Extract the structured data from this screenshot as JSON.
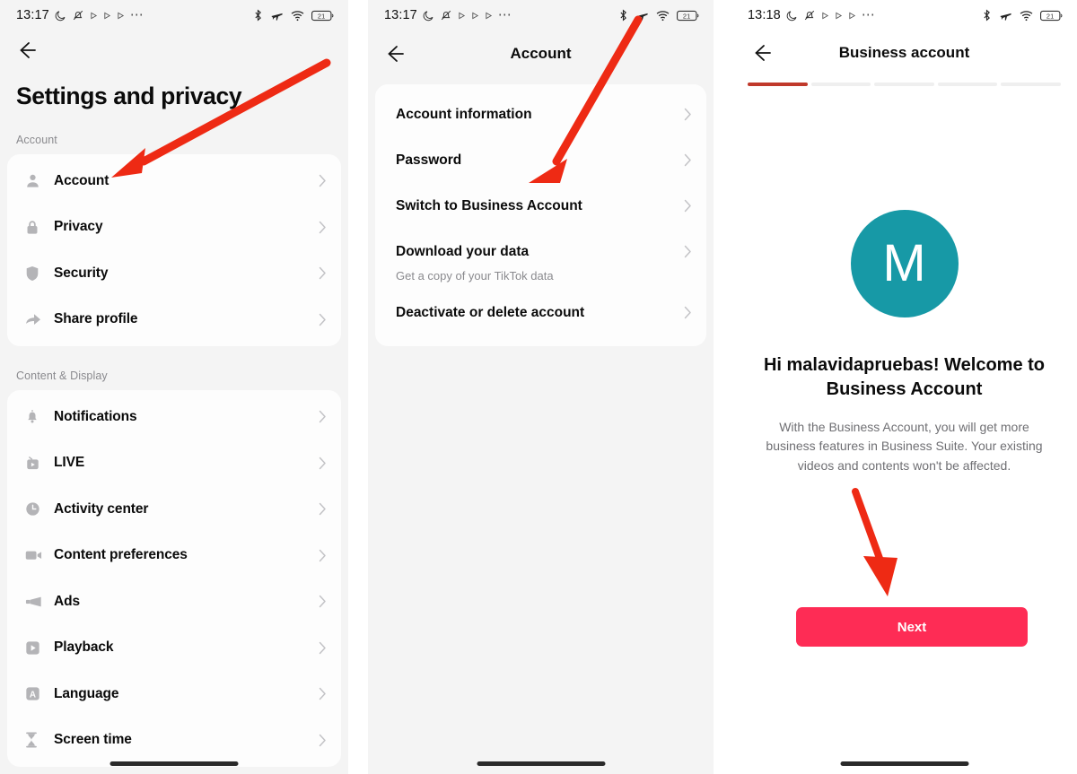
{
  "accent": {
    "arrow_red": "#ee2a14",
    "button_red": "#fe2c55",
    "avatar_teal": "#1799a6",
    "progress_active": "#c0392b"
  },
  "panel1": {
    "status_bar": {
      "time": "13:17",
      "left_icons": [
        "moon-icon",
        "bell-muted-icon",
        "play-icon",
        "play-icon",
        "play-icon",
        "ellipsis-icon"
      ],
      "right_icons": [
        "bluetooth-icon",
        "airplane-icon",
        "wifi-icon",
        "battery-icon"
      ],
      "battery_level": "21"
    },
    "back_label": "back-arrow",
    "title": "Settings and privacy",
    "sections": [
      {
        "label": "Account",
        "items": [
          {
            "icon": "person-icon",
            "label": "Account"
          },
          {
            "icon": "lock-icon",
            "label": "Privacy"
          },
          {
            "icon": "shield-icon",
            "label": "Security"
          },
          {
            "icon": "share-arrow-icon",
            "label": "Share profile"
          }
        ]
      },
      {
        "label": "Content & Display",
        "items": [
          {
            "icon": "bell-icon",
            "label": "Notifications"
          },
          {
            "icon": "live-icon",
            "label": "LIVE"
          },
          {
            "icon": "clock-icon",
            "label": "Activity center"
          },
          {
            "icon": "video-camera-icon",
            "label": "Content preferences"
          },
          {
            "icon": "megaphone-icon",
            "label": "Ads"
          },
          {
            "icon": "play-square-icon",
            "label": "Playback"
          },
          {
            "icon": "letter-a-icon",
            "label": "Language"
          },
          {
            "icon": "hourglass-icon",
            "label": "Screen time"
          }
        ]
      }
    ]
  },
  "panel2": {
    "status_bar": {
      "time": "13:17",
      "battery_level": "21"
    },
    "title": "Account",
    "items": [
      {
        "label": "Account information",
        "sub": ""
      },
      {
        "label": "Password",
        "sub": ""
      },
      {
        "label": "Switch to Business Account",
        "sub": ""
      },
      {
        "label": "Download your data",
        "sub": "Get a copy of your TikTok data"
      },
      {
        "label": "Deactivate or delete account",
        "sub": ""
      }
    ]
  },
  "panel3": {
    "status_bar": {
      "time": "13:18",
      "battery_level": "21"
    },
    "title": "Business account",
    "progress": {
      "segments": 5,
      "active": 1
    },
    "avatar_letter": "M",
    "heading": "Hi malavidapruebas! Welcome to Business Account",
    "body": "With the Business Account, you will get more business features in Business Suite. Your existing videos and contents won't be affected.",
    "next_label": "Next"
  }
}
